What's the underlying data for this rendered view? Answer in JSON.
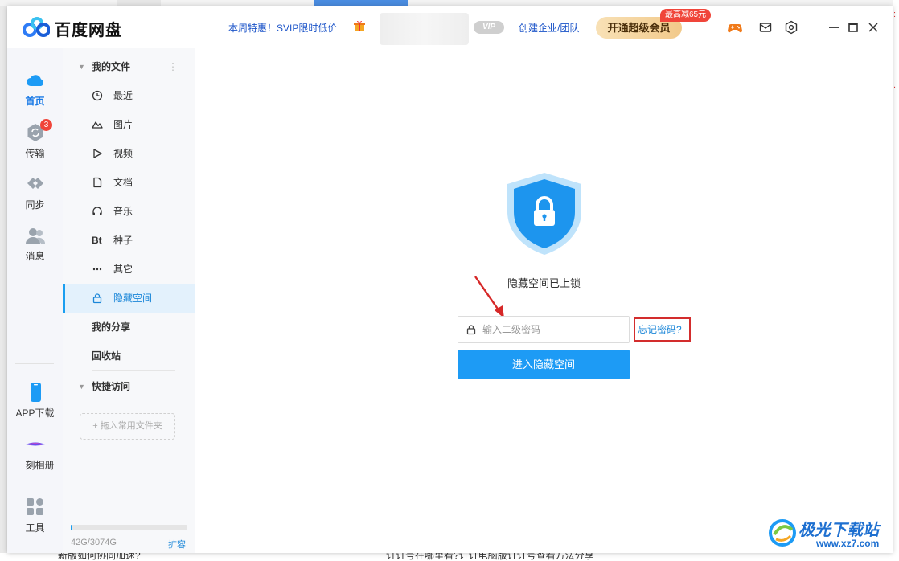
{
  "background": {
    "bottom_fragments": [
      "新版如何协同加速?",
      "订订号在哪里看?订订电脑版订订号查看方法分享"
    ]
  },
  "titlebar": {
    "app_name": "百度网盘",
    "promo_text": "本周特惠！SVIP限时低价",
    "vip_badge": "VIP",
    "create_team": "创建企业/团队",
    "svip_button": "开通超级会员",
    "discount_tag": "最高减65元",
    "icons": [
      "gamepad-icon",
      "mail-icon",
      "settings-icon",
      "minimize-icon",
      "maximize-icon",
      "close-icon"
    ]
  },
  "rail": {
    "items": [
      {
        "label": "首页",
        "icon": "cloud-icon",
        "active": true
      },
      {
        "label": "传输",
        "icon": "transfer-icon",
        "badge": "3"
      },
      {
        "label": "同步",
        "icon": "sync-icon"
      },
      {
        "label": "消息",
        "icon": "message-icon"
      }
    ],
    "bottom_items": [
      {
        "label": "APP下载",
        "icon": "phone-icon"
      },
      {
        "label": "一刻相册",
        "icon": "album-icon"
      },
      {
        "label": "工具",
        "icon": "tools-icon"
      }
    ]
  },
  "sidebar": {
    "my_files": "我的文件",
    "items": [
      {
        "label": "最近",
        "icon": "clock-icon"
      },
      {
        "label": "图片",
        "icon": "image-icon"
      },
      {
        "label": "视频",
        "icon": "video-icon"
      },
      {
        "label": "文档",
        "icon": "document-icon"
      },
      {
        "label": "音乐",
        "icon": "headphone-icon"
      },
      {
        "label": "种子",
        "icon": "torrent-icon",
        "glyph": "Bt"
      },
      {
        "label": "其它",
        "icon": "more-icon"
      },
      {
        "label": "隐藏空间",
        "icon": "lock-icon",
        "selected": true
      }
    ],
    "my_share": "我的分享",
    "recycle_bin": "回收站",
    "quick_access": "快捷访问",
    "drop_hint": "+ 拖入常用文件夹",
    "storage_text": "42G/3074G",
    "storage_fraction": 0.014,
    "expand": "扩容"
  },
  "main": {
    "locked_text": "隐藏空间已上锁",
    "password_placeholder": "输入二级密码",
    "password_value": "",
    "forgot_link": "忘记密码?",
    "enter_button": "进入隐藏空间"
  },
  "watermark": {
    "title": "极光下载站",
    "url": "www.xz7.com"
  },
  "colors": {
    "accent": "#1d9bf5",
    "highlight_box": "#d32d2d",
    "link": "#1a53c8"
  }
}
